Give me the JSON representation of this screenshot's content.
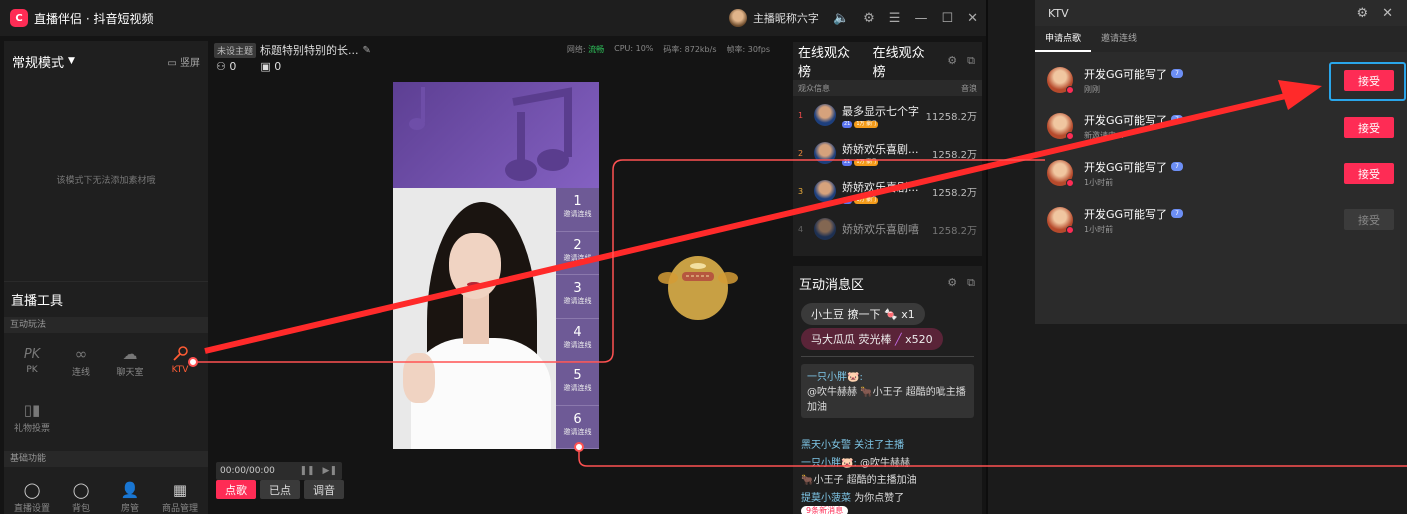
{
  "titlebar": {
    "logo": "C",
    "app_name": "直播伴侣 · 抖音短视频",
    "username": "主播昵称六字",
    "icons": [
      "speaker-icon",
      "gear-icon",
      "menu-icon",
      "minimize-icon",
      "maximize-icon",
      "close-icon"
    ]
  },
  "left": {
    "mode_label": "常规模式",
    "vertical_label": "竖屏",
    "empty_text": "该模式下无法添加素材哦",
    "tools_title": "直播工具",
    "interactive_label": "互动玩法",
    "tools": [
      {
        "label": "PK",
        "icon": "PK"
      },
      {
        "label": "连线",
        "icon": "∞"
      },
      {
        "label": "聊天室",
        "icon": "☁"
      },
      {
        "label": "KTV",
        "icon": "🎤"
      }
    ],
    "gift_vote_label": "礼物投票",
    "basic_label": "基础功能",
    "basic_tools": [
      "直播设置",
      "背包",
      "房管",
      "商品管理"
    ]
  },
  "center": {
    "untitled_tag": "未设主题",
    "stream_title": "标题特别特别的长...",
    "viewers_count": "0",
    "gifts_count": "0",
    "stats": {
      "network_label": "网络:",
      "network_value": "流畅",
      "cpu": "CPU: 10%",
      "bitrate": "码率: 872kb/s",
      "fps": "帧率: 30fps"
    },
    "slots": [
      {
        "num": "1",
        "label": "邀请连线"
      },
      {
        "num": "2",
        "label": "邀请连线"
      },
      {
        "num": "3",
        "label": "邀请连线"
      },
      {
        "num": "4",
        "label": "邀请连线"
      },
      {
        "num": "5",
        "label": "邀请连线"
      },
      {
        "num": "6",
        "label": "邀请连线"
      }
    ],
    "player_time": "00:00/00:00",
    "buttons": [
      "点歌",
      "已点",
      "调音"
    ]
  },
  "audience": {
    "tab1": "在线观众榜",
    "tab2": "在线观众榜",
    "col_info": "观众信息",
    "col_value": "音浪",
    "rows": [
      {
        "rank": "1",
        "name": "最多显示七个字",
        "value": "11258.2万",
        "badges": [
          "21",
          "1万 豪门"
        ]
      },
      {
        "rank": "2",
        "name": "娇娇欢乐喜剧...",
        "value": "1258.2万",
        "badges": [
          "21",
          "1万 豪门"
        ]
      },
      {
        "rank": "3",
        "name": "娇娇欢乐喜剧...",
        "value": "1258.2万",
        "badges": [
          "21",
          "1万 豪门"
        ]
      },
      {
        "rank": "4",
        "name": "娇娇欢乐喜剧嘻",
        "value": "1258.2万",
        "badges": []
      }
    ],
    "accent": "#f39b1a"
  },
  "interact": {
    "title": "互动消息区",
    "pill1_user": "小土豆",
    "pill1_action": "撩一下",
    "pill1_count": "x1",
    "pill2_user": "马大瓜瓜",
    "pill2_action": "荧光棒",
    "pill2_count": "x520",
    "box_user": "一只小胖🐷:",
    "box_text": "@吹牛赫赫 🐂小王子 超酷的呲主播加油",
    "line1": "黑天小女警 关注了主播",
    "line2_user": "一只小胖🐷:",
    "line2_text": "@吹牛赫赫",
    "line3": "🐂小王子  超酷的主播加油",
    "line4_user": "提莫小菠菜",
    "line4_text": "为你点赞了",
    "new_msgs": "9条新消息"
  },
  "ktv": {
    "title": "KTV",
    "tab_requests": "申请点歌",
    "tab_invite": "邀请连线",
    "requests": [
      {
        "name": "开发GG可能写了",
        "level": "7",
        "time": "刚刚",
        "button": "接受",
        "enabled": true
      },
      {
        "name": "开发GG可能写了",
        "level": "7",
        "time": "新邀请中...",
        "button": "接受",
        "enabled": true
      },
      {
        "name": "开发GG可能写了",
        "level": "7",
        "time": "1小时前",
        "button": "接受",
        "enabled": true
      },
      {
        "name": "开发GG可能写了",
        "level": "7",
        "time": "1小时前",
        "button": "接受",
        "enabled": false
      }
    ]
  },
  "colors": {
    "brand": "#fe2c55",
    "highlight": "#2aa6ea",
    "annotation": "#ff2a2a",
    "ktv_active": "#ff5c35"
  }
}
